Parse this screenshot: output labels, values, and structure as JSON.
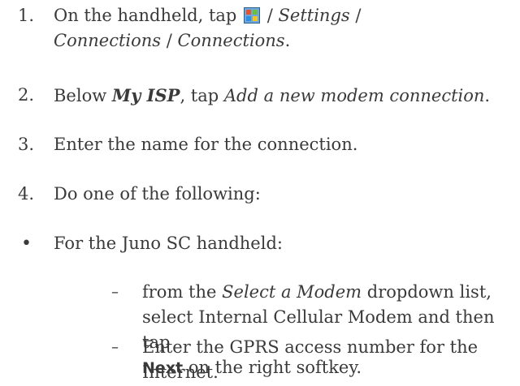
{
  "steps": [
    {
      "number": "1.",
      "line1_prefix": "On the handheld, tap",
      "line1_sep": "/",
      "line1_settings": "Settings",
      "line1_sep2": "/",
      "line2_connections": "Connections",
      "line2_sep": "/",
      "line2_connections2": "Connections",
      "line2_end": ".",
      "icon": "windows-start-icon"
    },
    {
      "number": "2.",
      "prefix": "Below",
      "bold_italic": "My ISP",
      "middle": ", tap",
      "italic": "Add a new modem connection",
      "end": "."
    },
    {
      "number": "3.",
      "text": "Enter the name for the connection."
    },
    {
      "number": "4.",
      "text": "Do one of the following:"
    }
  ],
  "bullet": {
    "symbol": "•",
    "text": "For the Juno SC handheld:"
  },
  "substeps": [
    {
      "symbol": "–",
      "line1_prefix": "from the",
      "line1_italic": "Select a Modem",
      "line1_suffix": "dropdown list,",
      "line2": "select Internal Cellular Modem and then tap",
      "line3_bold": "Next",
      "line3_suffix": "on the right softkey."
    },
    {
      "symbol": "–",
      "line1": "Enter the GPRS access number for the",
      "line2": "Internet."
    }
  ]
}
